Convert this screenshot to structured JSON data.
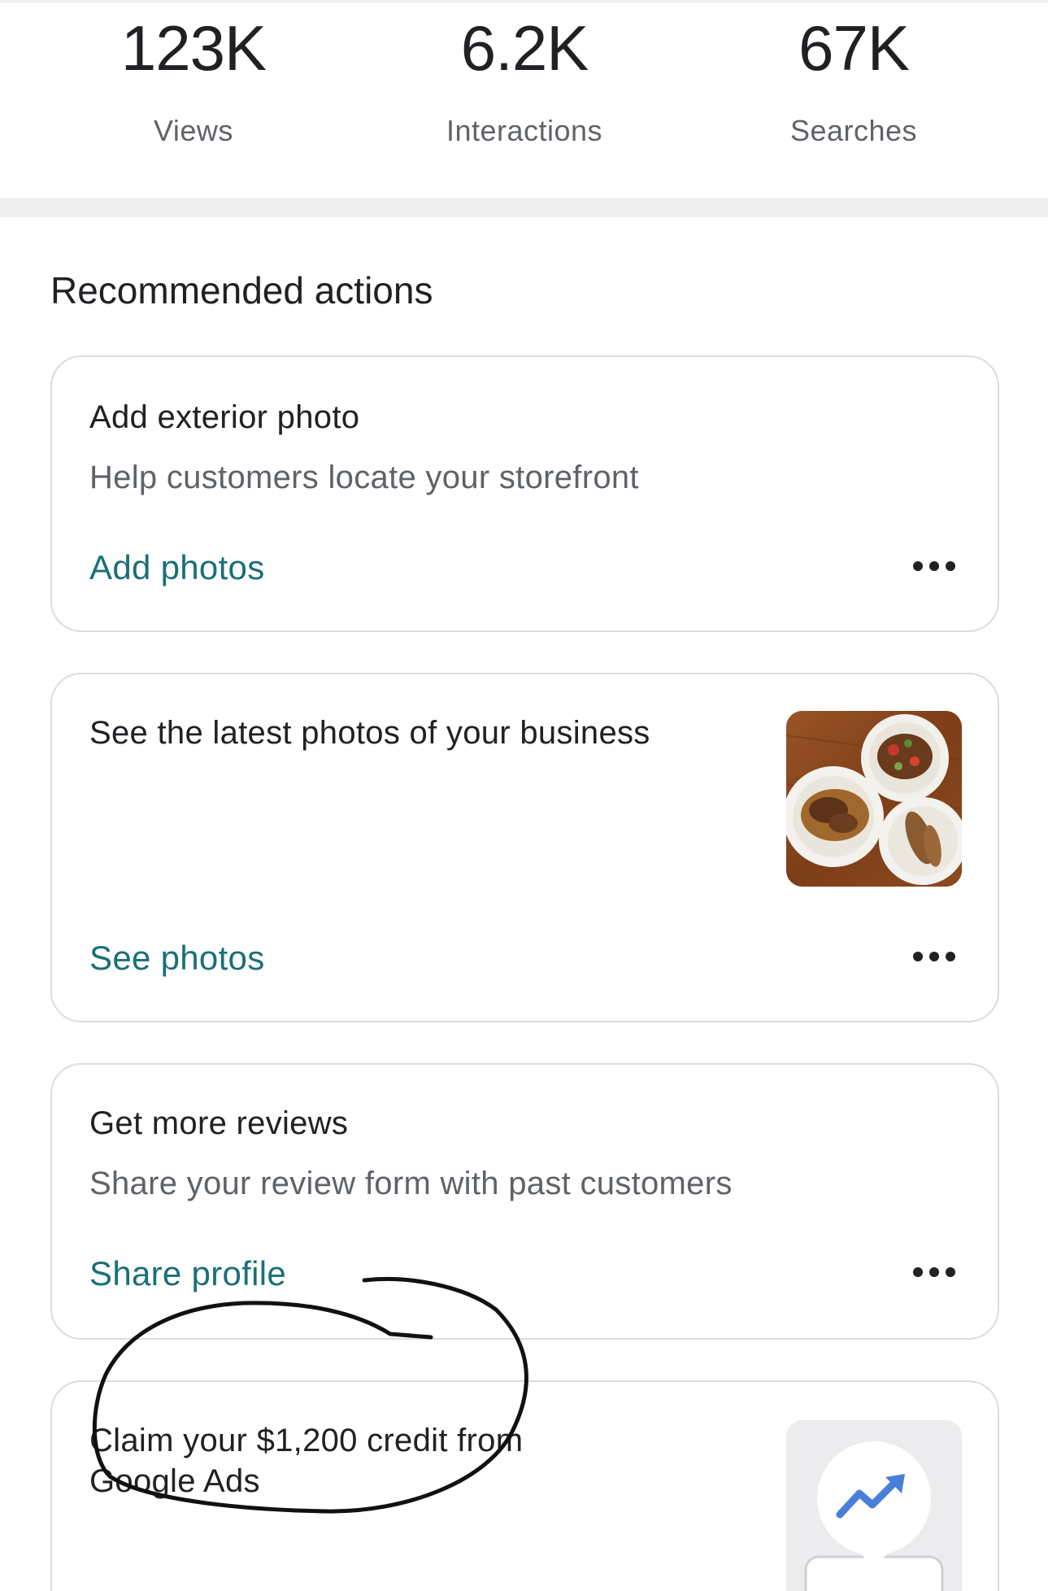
{
  "stats": [
    {
      "value": "123K",
      "label": "Views"
    },
    {
      "value": "6.2K",
      "label": "Interactions"
    },
    {
      "value": "67K",
      "label": "Searches"
    }
  ],
  "section_title": "Recommended actions",
  "cards": [
    {
      "title": "Add exterior photo",
      "description": "Help customers locate your storefront",
      "action": "Add photos"
    },
    {
      "title": "See the latest photos of your business",
      "action": "See photos"
    },
    {
      "title": "Get more reviews",
      "description": "Share your review form with past customers",
      "action": "Share profile"
    },
    {
      "title_line1": "Claim your $1,200 credit from",
      "title_line2": "Google Ads"
    }
  ],
  "icons": {
    "more": "more-horizontal-icon",
    "photo": "food-photo-thumbnail",
    "ads": "trending-up-icon"
  },
  "colors": {
    "link": "#1a6f78",
    "ads_trend": "#4a7fd8",
    "annotation": "#111111"
  }
}
